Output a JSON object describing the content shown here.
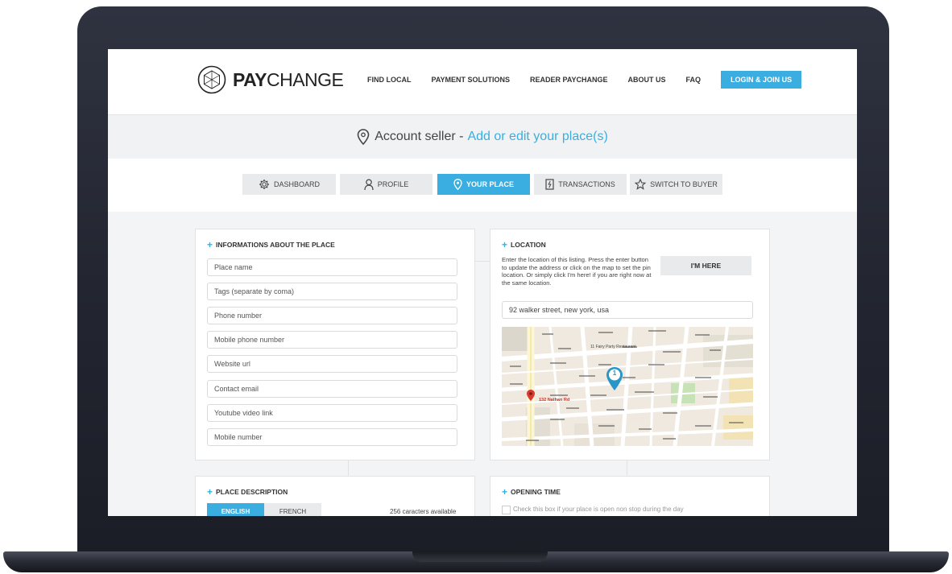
{
  "brand": {
    "name_bold": "PAY",
    "name_light": "CHANGE"
  },
  "nav": {
    "items": [
      "FIND LOCAL",
      "PAYMENT SOLUTIONS",
      "READER PAYCHANGE",
      "ABOUT US",
      "FAQ"
    ],
    "login": "LOGIN & JOIN US"
  },
  "page_title": {
    "prefix": "Account seller - ",
    "accent": "Add or edit your place(s)"
  },
  "tabs": [
    {
      "label": "DASHBOARD",
      "icon": "gear-icon"
    },
    {
      "label": "PROFILE",
      "icon": "user-icon"
    },
    {
      "label": "YOUR PLACE",
      "icon": "pin-icon",
      "active": true
    },
    {
      "label": "TRANSACTIONS",
      "icon": "document-icon"
    },
    {
      "label": "SWITCH TO BUYER",
      "icon": "star-icon"
    }
  ],
  "info_card": {
    "title": "INFORMATIONS ABOUT THE PLACE",
    "placeholders": [
      "Place name",
      "Tags (separate by coma)",
      "Phone number",
      "Mobile phone number",
      "Website url",
      "Contact email",
      "Youtube video link",
      "Mobile number"
    ]
  },
  "location_card": {
    "title": "LOCATION",
    "instructions": "Enter the location of this listing. Press the enter button to update the address or click on the map to set the pin location. Or simply click I'm here! if you are right now at the same location.",
    "button": "I'M HERE",
    "address": "92 walker street, new york, usa",
    "map": {
      "pin_number": "1",
      "marker_label": "132 Nathan Rd",
      "place_label": "11 Fairy Party Restaurant"
    }
  },
  "description_card": {
    "title": "PLACE DESCRIPTION",
    "languages": [
      "ENGLISH",
      "FRENCH"
    ],
    "active_language": "ENGLISH",
    "chars_available": "256 caracters available"
  },
  "opening_card": {
    "title": "OPENING TIME",
    "nonstop_label": "Check this box if your place is open non stop during the day"
  },
  "colors": {
    "accent": "#3aaee0",
    "bezel": "#262933"
  }
}
